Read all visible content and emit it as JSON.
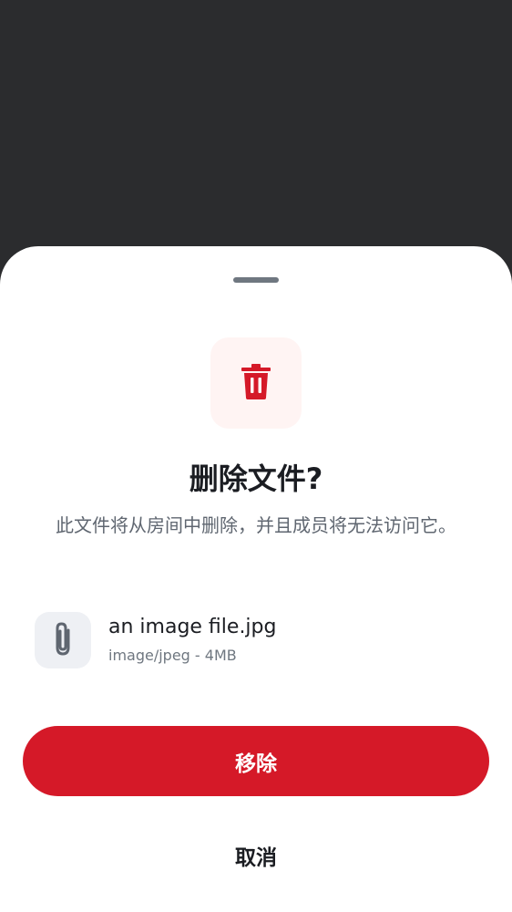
{
  "dialog": {
    "title": "删除文件?",
    "message": "此文件将从房间中删除，并且成员将无法访问它。",
    "header_icon": "trash-icon",
    "accent_color": "#d51928"
  },
  "file": {
    "icon": "paperclip-icon",
    "name": "an image file.jpg",
    "meta": "image/jpeg - 4MB"
  },
  "actions": {
    "remove_label": "移除",
    "cancel_label": "取消"
  }
}
